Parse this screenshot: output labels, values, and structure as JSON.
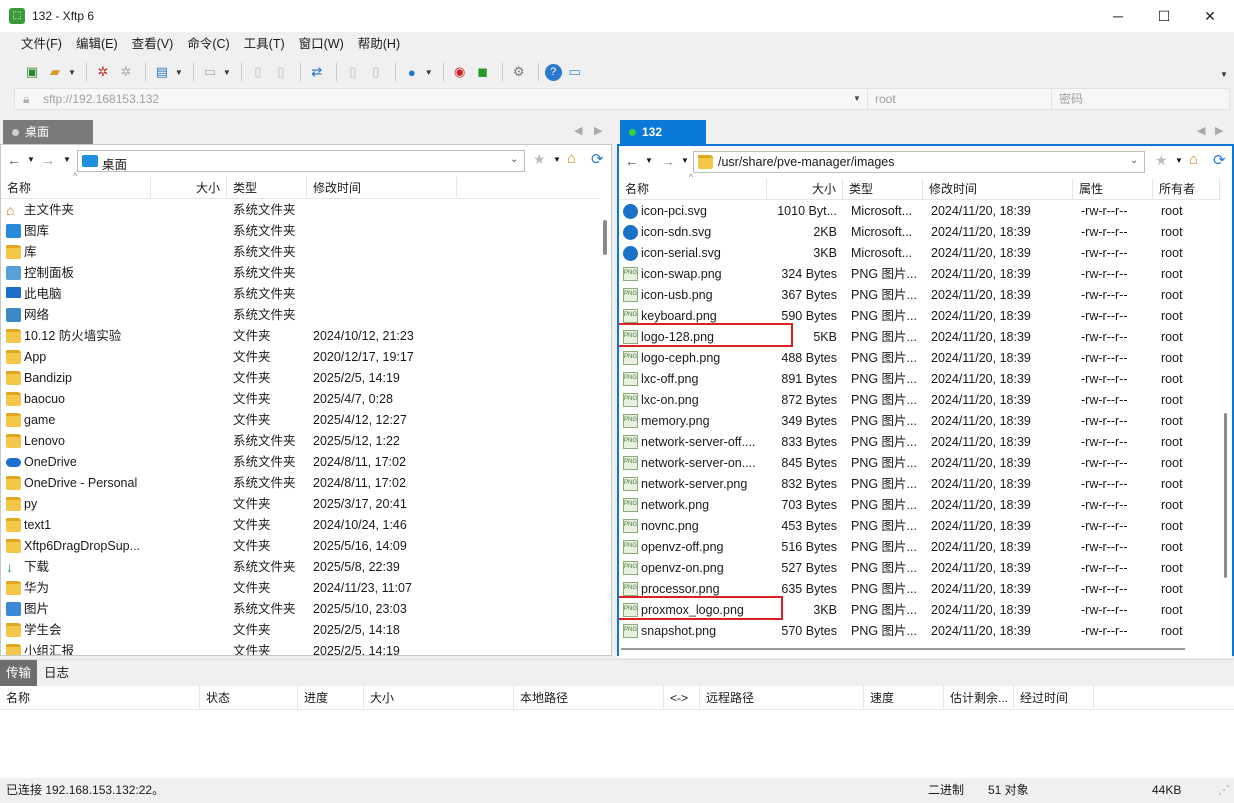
{
  "window": {
    "title": "132 - Xftp 6",
    "app_icon": "xftp-icon",
    "minimize": "─",
    "maximize": "☐",
    "close": "✕"
  },
  "menu": [
    "文件(F)",
    "编辑(E)",
    "查看(V)",
    "命令(C)",
    "工具(T)",
    "窗口(W)",
    "帮助(H)"
  ],
  "address": {
    "host": "sftp://192.168153.132",
    "user_placeholder": "root",
    "password_placeholder": "密码"
  },
  "left": {
    "tab": "桌面",
    "path": "桌面",
    "headers": [
      "名称",
      "大小",
      "类型",
      "修改时间"
    ],
    "rows": [
      {
        "name": "主文件夹",
        "size": "",
        "type": "系统文件夹",
        "mtime": "",
        "icon": "home-icon"
      },
      {
        "name": "图库",
        "size": "",
        "type": "系统文件夹",
        "mtime": "",
        "icon": "gallery-icon"
      },
      {
        "name": "库",
        "size": "",
        "type": "系统文件夹",
        "mtime": "",
        "icon": "folder-icon"
      },
      {
        "name": "控制面板",
        "size": "",
        "type": "系统文件夹",
        "mtime": "",
        "icon": "control-panel-icon"
      },
      {
        "name": "此电脑",
        "size": "",
        "type": "系统文件夹",
        "mtime": "",
        "icon": "computer-icon"
      },
      {
        "name": "网络",
        "size": "",
        "type": "系统文件夹",
        "mtime": "",
        "icon": "network-icon"
      },
      {
        "name": "10.12 防火墙实验",
        "size": "",
        "type": "文件夹",
        "mtime": "2024/10/12, 21:23",
        "icon": "folder-icon"
      },
      {
        "name": "App",
        "size": "",
        "type": "文件夹",
        "mtime": "2020/12/17, 19:17",
        "icon": "folder-icon"
      },
      {
        "name": "Bandizip",
        "size": "",
        "type": "文件夹",
        "mtime": "2025/2/5, 14:19",
        "icon": "folder-icon"
      },
      {
        "name": "baocuo",
        "size": "",
        "type": "文件夹",
        "mtime": "2025/4/7, 0:28",
        "icon": "folder-icon"
      },
      {
        "name": "game",
        "size": "",
        "type": "文件夹",
        "mtime": "2025/4/12, 12:27",
        "icon": "folder-icon"
      },
      {
        "name": "Lenovo",
        "size": "",
        "type": "系统文件夹",
        "mtime": "2025/5/12, 1:22",
        "icon": "folder-icon"
      },
      {
        "name": "OneDrive",
        "size": "",
        "type": "系统文件夹",
        "mtime": "2024/8/11, 17:02",
        "icon": "cloud-icon"
      },
      {
        "name": "OneDrive - Personal",
        "size": "",
        "type": "系统文件夹",
        "mtime": "2024/8/11, 17:02",
        "icon": "folder-icon"
      },
      {
        "name": "py",
        "size": "",
        "type": "文件夹",
        "mtime": "2025/3/17, 20:41",
        "icon": "folder-icon"
      },
      {
        "name": "text1",
        "size": "",
        "type": "文件夹",
        "mtime": "2024/10/24, 1:46",
        "icon": "folder-icon"
      },
      {
        "name": "Xftp6DragDropSup...",
        "size": "",
        "type": "文件夹",
        "mtime": "2025/5/16, 14:09",
        "icon": "folder-icon"
      },
      {
        "name": "下载",
        "size": "",
        "type": "系统文件夹",
        "mtime": "2025/5/8, 22:39",
        "icon": "download-icon"
      },
      {
        "name": "华为",
        "size": "",
        "type": "文件夹",
        "mtime": "2024/11/23, 11:07",
        "icon": "folder-icon"
      },
      {
        "name": "图片",
        "size": "",
        "type": "系统文件夹",
        "mtime": "2025/5/10, 23:03",
        "icon": "pictures-icon"
      },
      {
        "name": "学生会",
        "size": "",
        "type": "文件夹",
        "mtime": "2025/2/5, 14:18",
        "icon": "folder-icon"
      },
      {
        "name": "小组汇报",
        "size": "",
        "type": "文件夹",
        "mtime": "2025/2/5, 14:19",
        "icon": "folder-icon"
      }
    ]
  },
  "right": {
    "tab": "132",
    "path": "/usr/share/pve-manager/images",
    "headers": [
      "名称",
      "大小",
      "类型",
      "修改时间",
      "属性",
      "所有者"
    ],
    "rows": [
      {
        "name": "icon-pci.svg",
        "size": "1010 Byt...",
        "type": "Microsoft...",
        "mtime": "2024/11/20, 18:39",
        "perm": "-rw-r--r--",
        "owner": "root",
        "icon": "edge-icon"
      },
      {
        "name": "icon-sdn.svg",
        "size": "2KB",
        "type": "Microsoft...",
        "mtime": "2024/11/20, 18:39",
        "perm": "-rw-r--r--",
        "owner": "root",
        "icon": "edge-icon"
      },
      {
        "name": "icon-serial.svg",
        "size": "3KB",
        "type": "Microsoft...",
        "mtime": "2024/11/20, 18:39",
        "perm": "-rw-r--r--",
        "owner": "root",
        "icon": "edge-icon"
      },
      {
        "name": "icon-swap.png",
        "size": "324 Bytes",
        "type": "PNG 图片...",
        "mtime": "2024/11/20, 18:39",
        "perm": "-rw-r--r--",
        "owner": "root",
        "icon": "png-icon"
      },
      {
        "name": "icon-usb.png",
        "size": "367 Bytes",
        "type": "PNG 图片...",
        "mtime": "2024/11/20, 18:39",
        "perm": "-rw-r--r--",
        "owner": "root",
        "icon": "png-icon"
      },
      {
        "name": "keyboard.png",
        "size": "590 Bytes",
        "type": "PNG 图片...",
        "mtime": "2024/11/20, 18:39",
        "perm": "-rw-r--r--",
        "owner": "root",
        "icon": "png-icon"
      },
      {
        "name": "logo-128.png",
        "size": "5KB",
        "type": "PNG 图片...",
        "mtime": "2024/11/20, 18:39",
        "perm": "-rw-r--r--",
        "owner": "root",
        "icon": "png-icon",
        "highlight": true
      },
      {
        "name": "logo-ceph.png",
        "size": "488 Bytes",
        "type": "PNG 图片...",
        "mtime": "2024/11/20, 18:39",
        "perm": "-rw-r--r--",
        "owner": "root",
        "icon": "png-icon"
      },
      {
        "name": "lxc-off.png",
        "size": "891 Bytes",
        "type": "PNG 图片...",
        "mtime": "2024/11/20, 18:39",
        "perm": "-rw-r--r--",
        "owner": "root",
        "icon": "png-icon"
      },
      {
        "name": "lxc-on.png",
        "size": "872 Bytes",
        "type": "PNG 图片...",
        "mtime": "2024/11/20, 18:39",
        "perm": "-rw-r--r--",
        "owner": "root",
        "icon": "png-icon"
      },
      {
        "name": "memory.png",
        "size": "349 Bytes",
        "type": "PNG 图片...",
        "mtime": "2024/11/20, 18:39",
        "perm": "-rw-r--r--",
        "owner": "root",
        "icon": "png-icon"
      },
      {
        "name": "network-server-off....",
        "size": "833 Bytes",
        "type": "PNG 图片...",
        "mtime": "2024/11/20, 18:39",
        "perm": "-rw-r--r--",
        "owner": "root",
        "icon": "png-icon"
      },
      {
        "name": "network-server-on....",
        "size": "845 Bytes",
        "type": "PNG 图片...",
        "mtime": "2024/11/20, 18:39",
        "perm": "-rw-r--r--",
        "owner": "root",
        "icon": "png-icon"
      },
      {
        "name": "network-server.png",
        "size": "832 Bytes",
        "type": "PNG 图片...",
        "mtime": "2024/11/20, 18:39",
        "perm": "-rw-r--r--",
        "owner": "root",
        "icon": "png-icon"
      },
      {
        "name": "network.png",
        "size": "703 Bytes",
        "type": "PNG 图片...",
        "mtime": "2024/11/20, 18:39",
        "perm": "-rw-r--r--",
        "owner": "root",
        "icon": "png-icon"
      },
      {
        "name": "novnc.png",
        "size": "453 Bytes",
        "type": "PNG 图片...",
        "mtime": "2024/11/20, 18:39",
        "perm": "-rw-r--r--",
        "owner": "root",
        "icon": "png-icon"
      },
      {
        "name": "openvz-off.png",
        "size": "516 Bytes",
        "type": "PNG 图片...",
        "mtime": "2024/11/20, 18:39",
        "perm": "-rw-r--r--",
        "owner": "root",
        "icon": "png-icon"
      },
      {
        "name": "openvz-on.png",
        "size": "527 Bytes",
        "type": "PNG 图片...",
        "mtime": "2024/11/20, 18:39",
        "perm": "-rw-r--r--",
        "owner": "root",
        "icon": "png-icon"
      },
      {
        "name": "processor.png",
        "size": "635 Bytes",
        "type": "PNG 图片...",
        "mtime": "2024/11/20, 18:39",
        "perm": "-rw-r--r--",
        "owner": "root",
        "icon": "png-icon"
      },
      {
        "name": "proxmox_logo.png",
        "size": "3KB",
        "type": "PNG 图片...",
        "mtime": "2024/11/20, 18:39",
        "perm": "-rw-r--r--",
        "owner": "root",
        "icon": "png-icon",
        "highlight": true
      },
      {
        "name": "snapshot.png",
        "size": "570 Bytes",
        "type": "PNG 图片...",
        "mtime": "2024/11/20, 18:39",
        "perm": "-rw-r--r--",
        "owner": "root",
        "icon": "png-icon"
      }
    ]
  },
  "transfer": {
    "tabs": [
      "传输",
      "日志"
    ],
    "headers": [
      "名称",
      "状态",
      "进度",
      "大小",
      "本地路径",
      "<->",
      "远程路径",
      "速度",
      "估计剩余...",
      "经过时间"
    ]
  },
  "status": {
    "connection": "已连接 192.168.153.132:22。",
    "mode": "二进制",
    "objects": "51 对象",
    "size": "44KB"
  },
  "colors": {
    "accent": "#0a78d7",
    "highlight_box": "#e02020",
    "folder": "#f4c64a"
  }
}
